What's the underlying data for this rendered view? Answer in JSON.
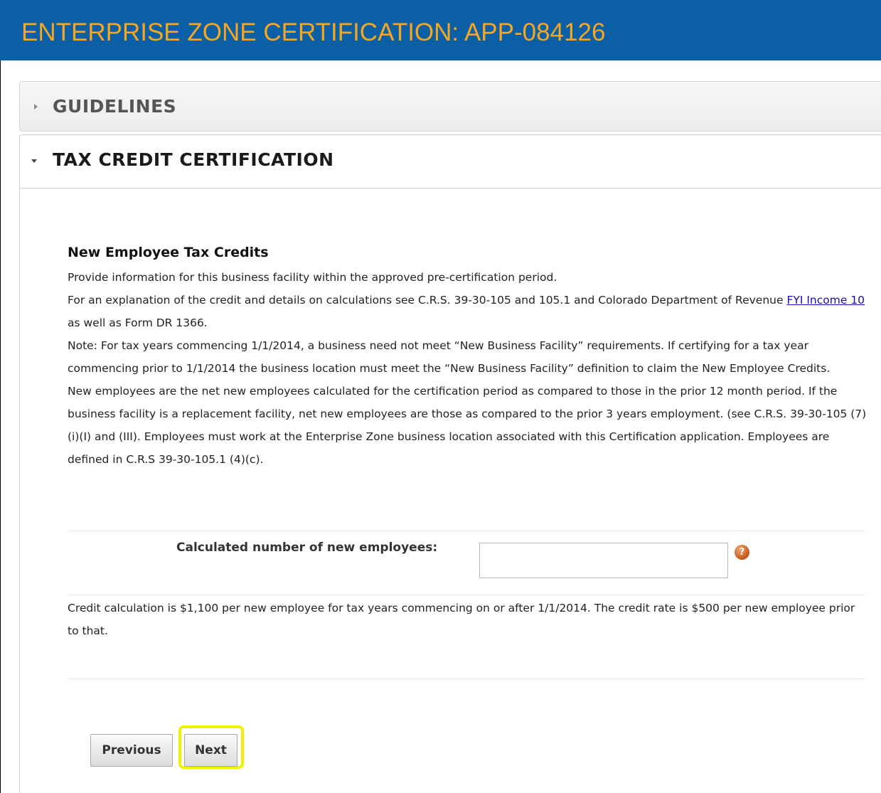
{
  "header": {
    "title": "ENTERPRISE ZONE CERTIFICATION: APP-084126",
    "background_color": "#0b5fa5",
    "title_color": "#f5a623"
  },
  "panels": {
    "guidelines": {
      "title": "GUIDELINES",
      "state": "collapsed",
      "icon": "triangle-right-icon"
    },
    "tax_credit": {
      "title": "TAX CREDIT CERTIFICATION",
      "state": "expanded",
      "icon": "triangle-down-icon"
    }
  },
  "section": {
    "title": "New Employee Tax Credits",
    "line1": "Provide information for this business facility within the approved pre-certification period.",
    "line2_before_link": "For an explanation of the credit and details on calculations see C.R.S. 39-30-105 and 105.1 and Colorado Department of Revenue ",
    "link_text": "FYI Income 10",
    "line2_after_link": " as well as Form DR 1366.",
    "note": "Note: For tax years commencing 1/1/2014, a business need not meet “New Business Facility” requirements. If certifying for a tax year commencing prior to 1/1/2014 the business location must meet the “New Business Facility” definition to claim the New Employee Credits.",
    "new_employees": "New employees are the net new employees calculated for the certification period as compared to those in the prior 12 month period. If the business facility is a replacement facility, net new employees are those as compared to the prior 3 years employment. (see C.R.S. 39-30-105 (7)(i)(I) and (III). Employees must work at the Enterprise Zone business location associated with this Certification application. Employees are defined in C.R.S 39-30-105.1 (4)(c)."
  },
  "field": {
    "label": "Calculated number of new employees:",
    "value": "",
    "help_glyph": "?",
    "help_icon": "question-mark-icon"
  },
  "credit_note": "Credit calculation is $1,100 per new employee for tax years commencing on or after 1/1/2014. The credit rate is $500 per new employee prior to that.",
  "buttons": {
    "previous": "Previous",
    "next": "Next",
    "highlight_color": "#f2f200"
  }
}
